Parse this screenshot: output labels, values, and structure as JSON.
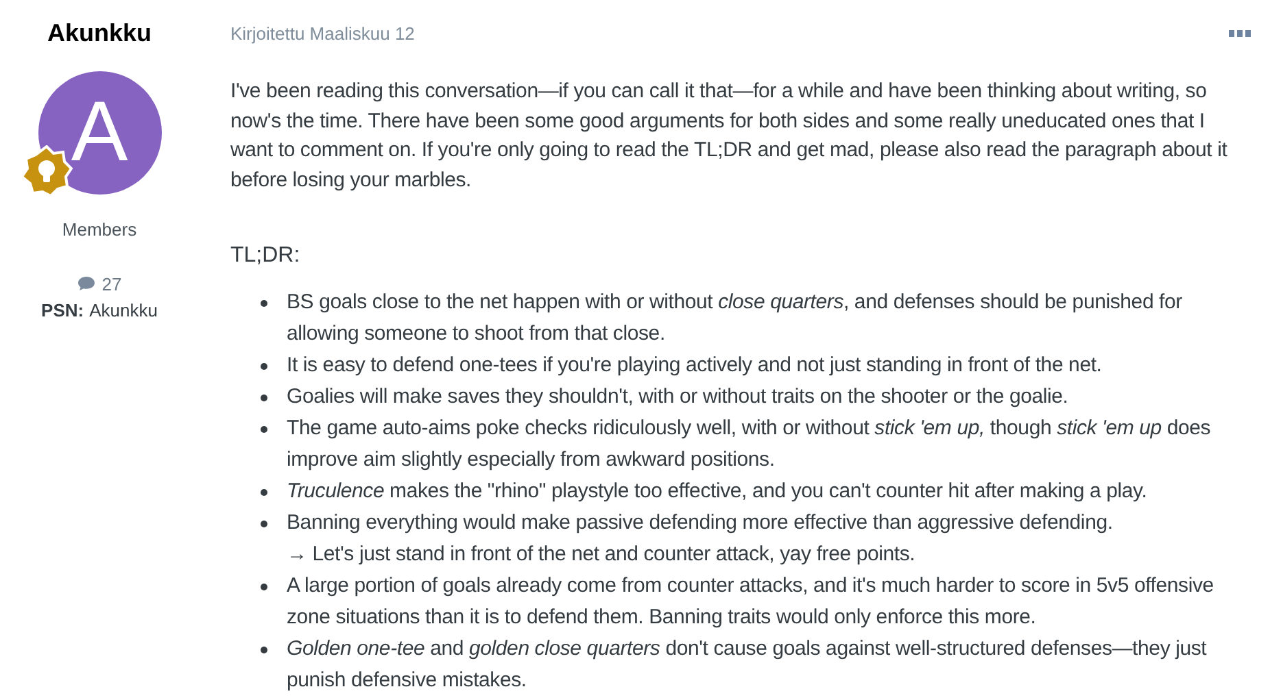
{
  "author": {
    "name": "Akunkku",
    "avatar_letter": "A",
    "group": "Members",
    "post_count": "27",
    "psn_label": "PSN:",
    "psn_value": "Akunkku"
  },
  "post": {
    "date": "Kirjoitettu Maaliskuu 12",
    "intro": "I've been reading this conversation—if you can call it that—for a while and have been thinking about writing, so now's the time. There have been some good arguments for both sides and some really uneducated ones that I want to comment on. If you're only going to read the TL;DR and get mad, please also read the paragraph about it before losing your marbles.",
    "heading": "TL;DR:",
    "bullets": [
      {
        "text": "BS goals close to the net happen with or without *close quarters*, and defenses should be punished for allowing someone to shoot from that close."
      },
      {
        "text": "It is easy to defend one-tees if you're playing actively and not just standing in front of the net."
      },
      {
        "text": "Goalies will make saves they shouldn't, with or without traits on the shooter or the goalie."
      },
      {
        "text": "The game auto-aims poke checks ridiculously well, with or without *stick 'em up,* though *stick 'em up* does improve aim slightly especially from awkward positions."
      },
      {
        "text": "*Truculence* makes the \"rhino\" playstyle too effective, and you can't counter hit after making a play."
      },
      {
        "text": "Banning everything would make passive defending more effective than aggressive defending.",
        "note": "→ Let's just stand in front of the net and counter attack, yay free points."
      },
      {
        "text": "A large portion of goals already come from counter attacks, and it's much harder to score in 5v5 offensive zone situations than it is to defend them. Banning traits would only enforce this more."
      },
      {
        "text": "*Golden one-tee* and *golden close quarters* don't cause goals against well-structured defenses—they just punish defensive mistakes."
      }
    ]
  }
}
